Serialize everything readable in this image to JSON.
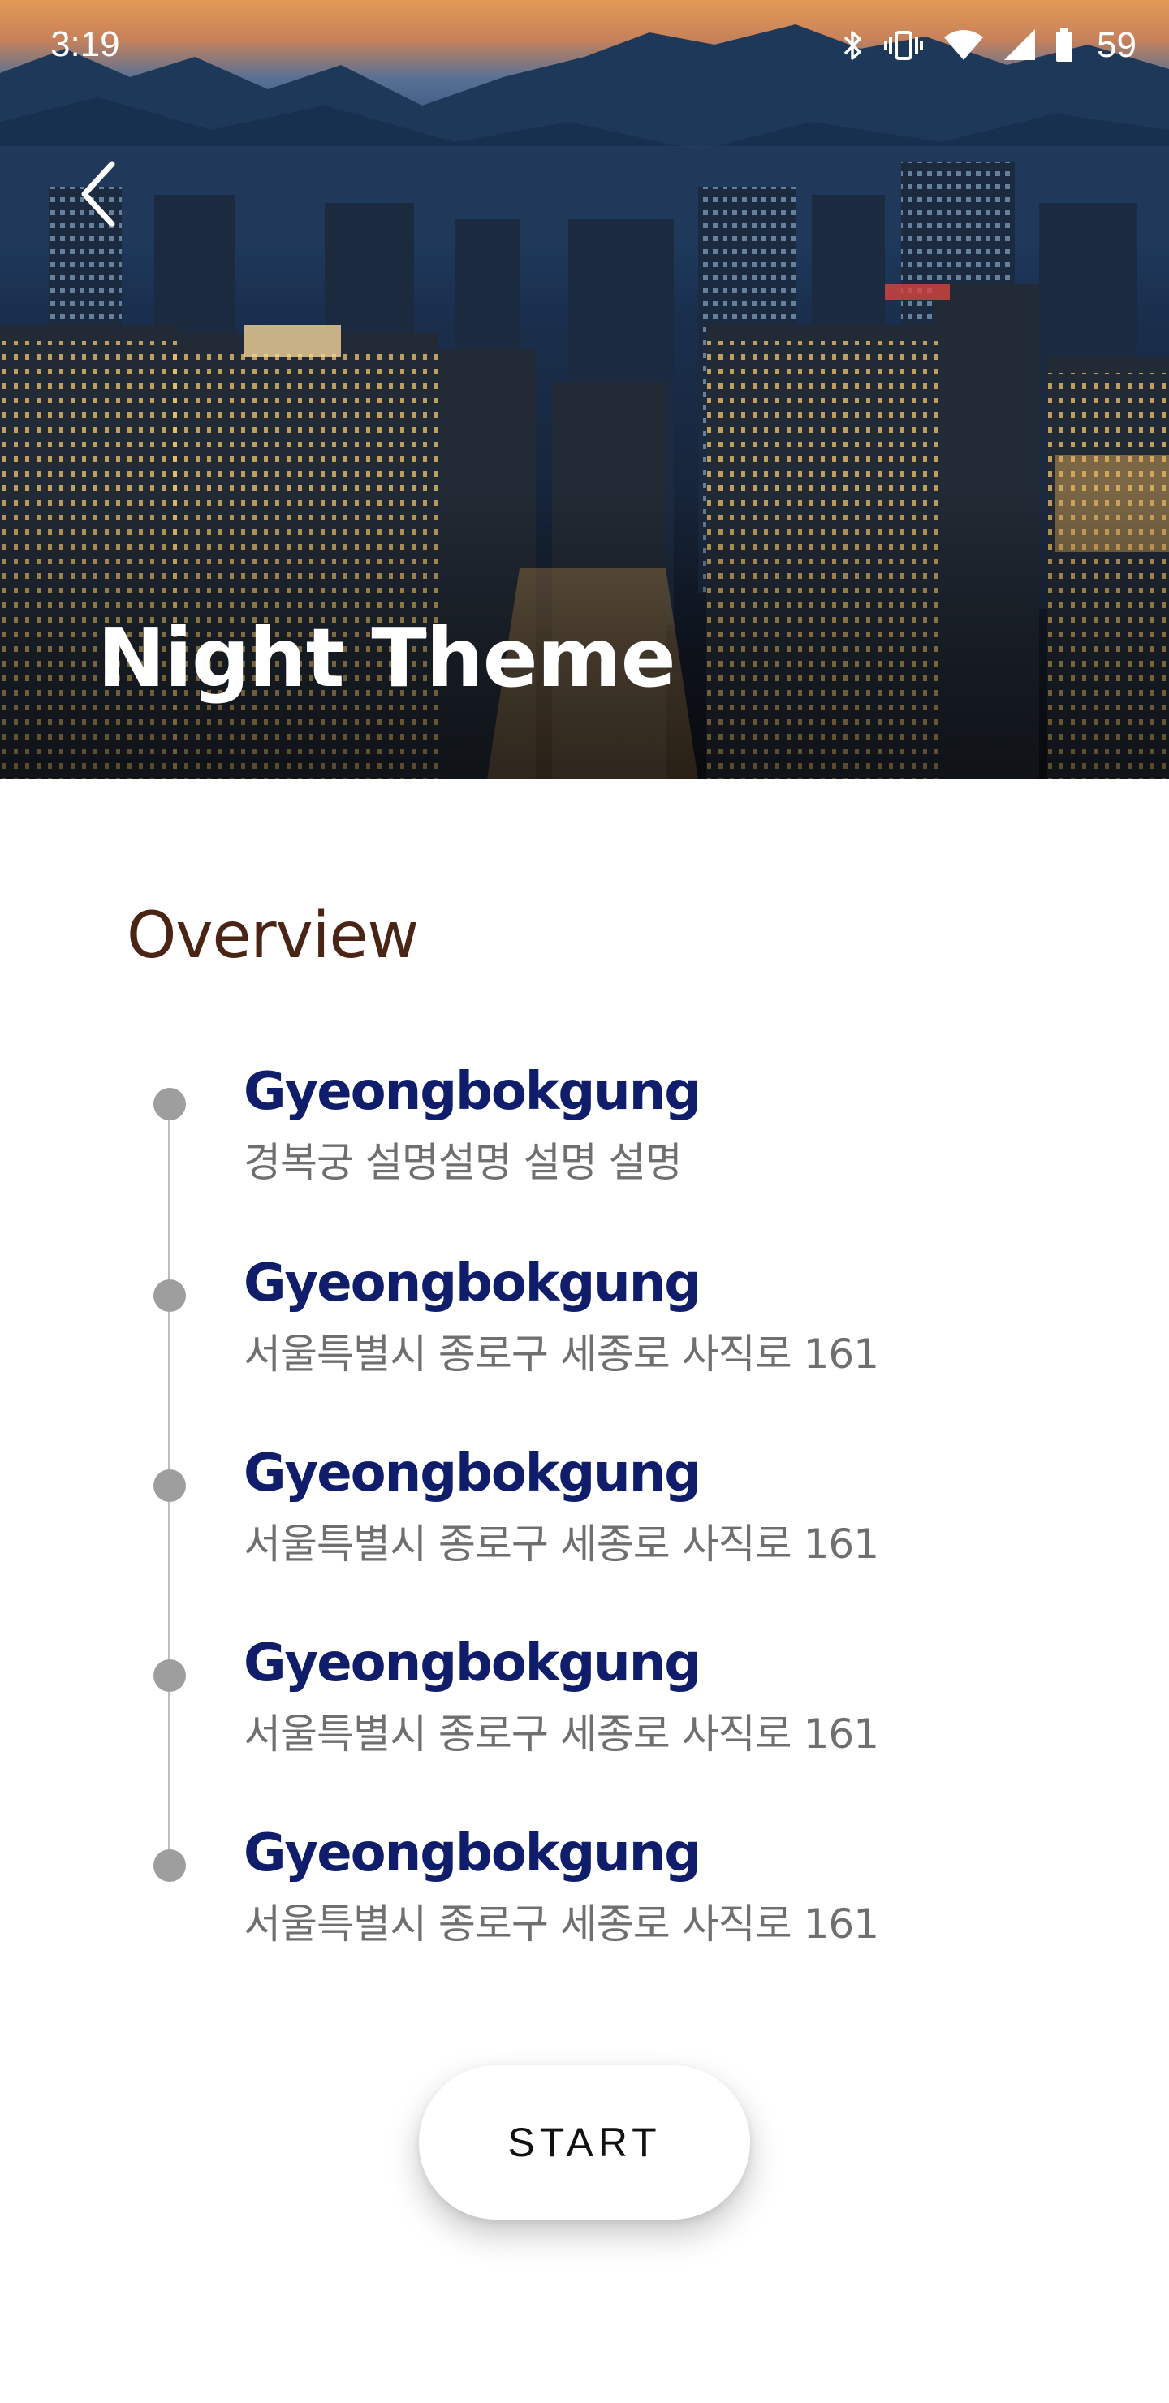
{
  "status_bar": {
    "time": "3:19",
    "battery": "59",
    "icons": [
      "bluetooth-icon",
      "vibrate-icon",
      "wifi-icon",
      "cell-signal-icon",
      "battery-icon"
    ]
  },
  "hero": {
    "title": "Night Theme",
    "back_icon": "chevron-left-icon"
  },
  "overview": {
    "heading": "Overview",
    "items": [
      {
        "title": "Gyeongbokgung",
        "subtitle": "경복궁 설명설명 설명 설명"
      },
      {
        "title": "Gyeongbokgung",
        "subtitle": "서울특별시 종로구 세종로 사직로 161"
      },
      {
        "title": "Gyeongbokgung",
        "subtitle": "서울특별시 종로구 세종로 사직로 161"
      },
      {
        "title": "Gyeongbokgung",
        "subtitle": "서울특별시 종로구 세종로 사직로 161"
      },
      {
        "title": "Gyeongbokgung",
        "subtitle": "서울특별시 종로구 세종로 사직로 161"
      }
    ]
  },
  "actions": {
    "start_label": "START"
  },
  "colors": {
    "overview_heading": "#4a2516",
    "item_title": "#0f1d6b",
    "item_subtitle": "#6f6f6f",
    "timeline": "#9e9e9e"
  }
}
